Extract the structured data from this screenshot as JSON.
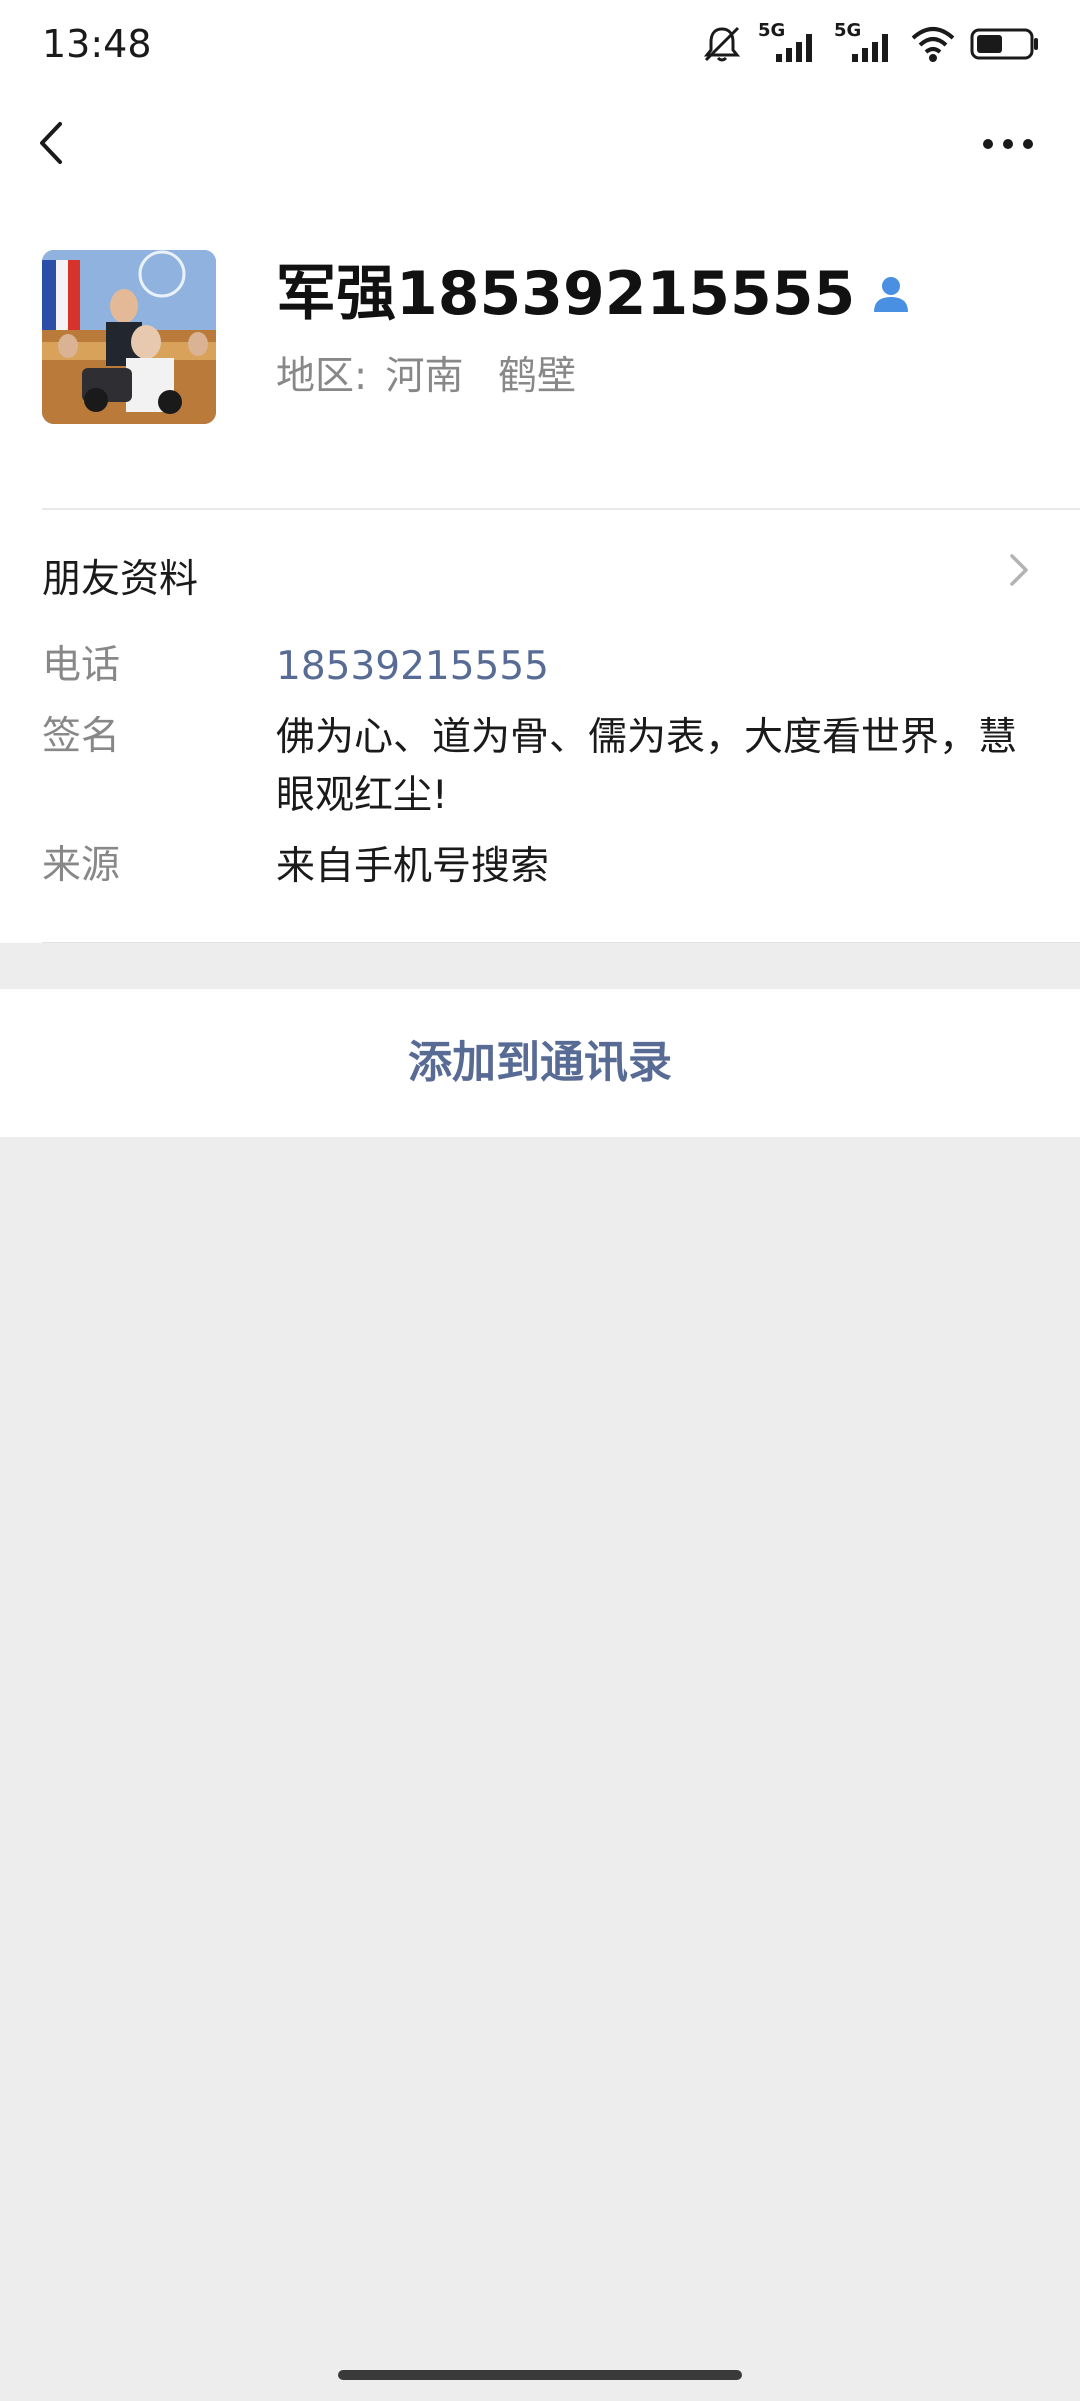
{
  "status_bar": {
    "time": "13:48",
    "sim1_label": "5G",
    "sim2_label": "5G",
    "battery_level": 0.5
  },
  "profile": {
    "name": "军强18539215555",
    "region_label": "地区:",
    "region_province": "河南",
    "region_city": "鹤壁"
  },
  "friend_info": {
    "title": "朋友资料",
    "rows": [
      {
        "label": "电话",
        "value": "18539215555"
      },
      {
        "label": "签名",
        "value": "佛为心、道为骨、儒为表，大度看世界，慧眼观红尘!"
      },
      {
        "label": "来源",
        "value": "来自手机号搜索"
      }
    ]
  },
  "actions": {
    "add_to_contacts": "添加到通讯录"
  },
  "colors": {
    "link": "#576b95",
    "page_bg": "#ededed",
    "card_bg": "#ffffff",
    "gender_icon": "#4a90e2"
  },
  "icons": {
    "back": "chevron-left-icon",
    "more": "more-dots-icon",
    "gender": "male-person-icon",
    "chevron": "chevron-right-icon",
    "mute": "bell-off-icon",
    "wifi": "wifi-icon",
    "battery": "battery-icon"
  }
}
